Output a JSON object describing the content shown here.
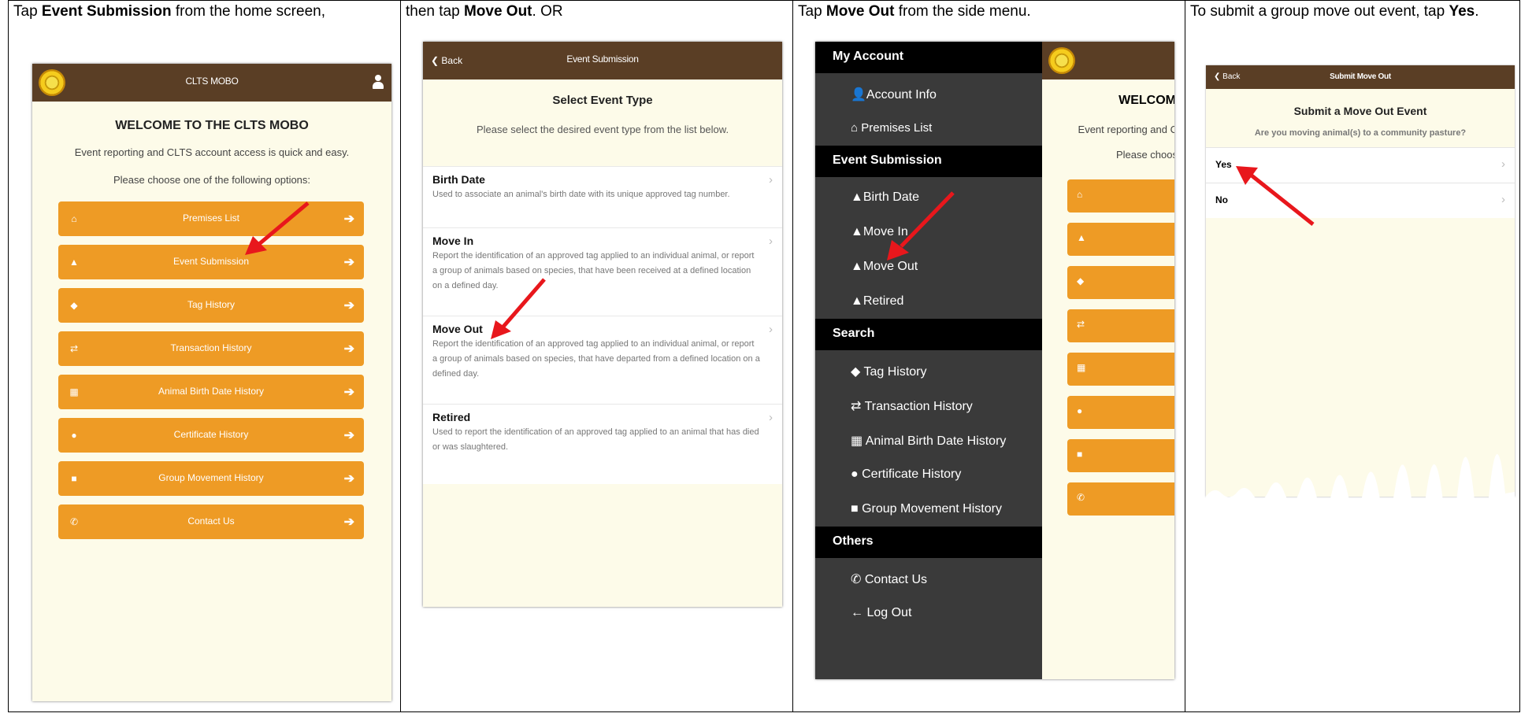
{
  "steps": [
    {
      "pre": "Tap ",
      "bold": "Event Submission",
      "post": " from the home screen,"
    },
    {
      "pre": "then tap ",
      "bold": "Move Out",
      "post": ". OR"
    },
    {
      "pre": "Tap ",
      "bold": "Move Out",
      "post": " from the side menu."
    },
    {
      "pre": "To submit a group move out event, tap ",
      "bold": "Yes",
      "post": "."
    }
  ],
  "home": {
    "title": "CLTS MOBO",
    "heading": "WELCOME TO THE CLTS MOBO",
    "line1": "Event reporting and CLTS account access is quick and easy.",
    "line2": "Please choose one of the following options:",
    "buttons": [
      {
        "label": "Premises List",
        "icon": "home-icon"
      },
      {
        "label": "Event Submission",
        "icon": "arrow-up-icon"
      },
      {
        "label": "Tag History",
        "icon": "tag-icon"
      },
      {
        "label": "Transaction History",
        "icon": "exchange-icon"
      },
      {
        "label": "Animal Birth Date History",
        "icon": "calendar-icon"
      },
      {
        "label": "Certificate History",
        "icon": "certificate-icon"
      },
      {
        "label": "Group Movement History",
        "icon": "truck-icon"
      },
      {
        "label": "Contact Us",
        "icon": "phone-icon"
      }
    ]
  },
  "event": {
    "back": "Back",
    "title": "Event Submission",
    "heading": "Select Event Type",
    "sub": "Please select the desired event type from the list below.",
    "items": [
      {
        "title": "Birth Date",
        "desc": "Used to associate an animal's birth date with its unique approved tag number."
      },
      {
        "title": "Move In",
        "desc": "Report the identification of an approved tag applied to an individual animal, or report a group of animals based on species, that have been received at a defined location on a defined day."
      },
      {
        "title": "Move Out",
        "desc": "Report the identification of an approved tag applied to an individual animal, or report a group of animals based on species, that have departed from a defined location on a defined day."
      },
      {
        "title": "Retired",
        "desc": "Used to report the identification of an approved tag applied to an animal that has died or was slaughtered."
      }
    ]
  },
  "drawer": {
    "sections": [
      {
        "header": "My Account",
        "items": [
          "Account Info",
          "Premises List"
        ]
      },
      {
        "header": "Event Submission",
        "items": [
          "Birth Date",
          "Move In",
          "Move Out",
          "Retired"
        ]
      },
      {
        "header": "Search",
        "items": [
          "Tag History",
          "Transaction History",
          "Animal Birth Date History",
          "Certificate History",
          "Group Movement History"
        ]
      },
      {
        "header": "Others",
        "items": [
          "Contact Us",
          "Log Out"
        ]
      }
    ],
    "peek_heading": "WELCOM",
    "peek_line1": "Event reporting and C",
    "peek_line2": "Please choos"
  },
  "moveout": {
    "back": "Back",
    "title": "Submit Move Out",
    "heading": "Submit a Move Out Event",
    "question": "Are you moving animal(s) to a community pasture?",
    "yes": "Yes",
    "no": "No"
  },
  "colors": {
    "header": "#5a3e25",
    "button": "#ee9b25",
    "background": "#fdfbe9",
    "arrow": "#e8171c"
  }
}
